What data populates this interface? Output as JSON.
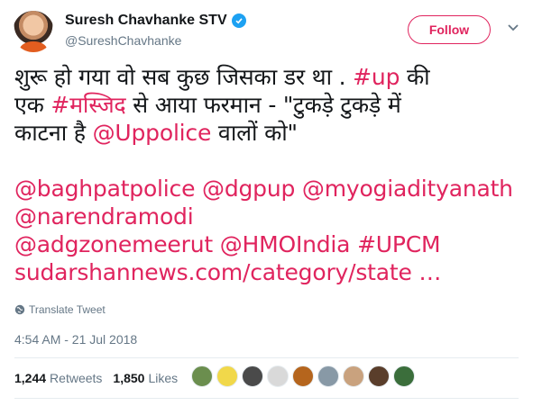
{
  "author": {
    "display_name": "Suresh Chavhanke STV",
    "handle": "@SureshChavhanke",
    "verified": true
  },
  "actions": {
    "follow_label": "Follow"
  },
  "tweet": {
    "line1_a": "शुरू हो गया वो सब कुछ जिसका डर था . ",
    "line1_tag": "#up",
    "line1_b": " की",
    "line2_a": "एक ",
    "line2_tag": "#मस्जिद",
    "line2_b": " से आया फरमान - \"टुकड़े टुकड़े में",
    "line3_a": "काटना है ",
    "line3_mention": "@Uppolice",
    "line3_b": " वालों को\"",
    "mention1": "@baghpatpolice",
    "mention2": "@dgpup",
    "mention3": "@myogiadityanath",
    "mention4": "@narendramodi",
    "mention5": "@adgzonemeerut",
    "mention6": "@HMOIndia",
    "hashtag_upcm": "#UPCM",
    "link": "sudarshannews.com/category/state",
    "ellipsis": "…"
  },
  "translate_label": "Translate Tweet",
  "timestamp": "4:54 AM - 21 Jul 2018",
  "stats": {
    "retweets_count": "1,244",
    "retweets_label": "Retweets",
    "likes_count": "1,850",
    "likes_label": "Likes"
  },
  "likers": [
    {
      "color": "#6b8e4e"
    },
    {
      "color": "#f1d84a"
    },
    {
      "color": "#4a4a4a"
    },
    {
      "color": "#d9d9d9"
    },
    {
      "color": "#b5651d"
    },
    {
      "color": "#8899a6"
    },
    {
      "color": "#c9a27e"
    },
    {
      "color": "#5a3e2b"
    },
    {
      "color": "#3b6e3b"
    }
  ],
  "colors": {
    "accent": "#e0245e",
    "verified": "#1da1f2",
    "muted": "#657786"
  }
}
